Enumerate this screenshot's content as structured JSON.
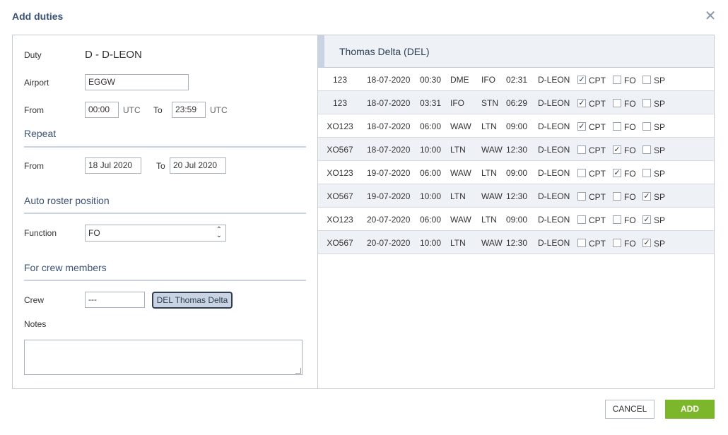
{
  "modal": {
    "title": "Add duties",
    "close_icon": "close-icon"
  },
  "form": {
    "duty_label": "Duty",
    "duty_value": "D - D-LEON",
    "airport_label": "Airport",
    "airport_value": "EGGW",
    "from_label": "From",
    "from_time": "00:00",
    "utc1": "UTC",
    "to_label": "To",
    "to_time": "23:59",
    "utc2": "UTC",
    "repeat_title": "Repeat",
    "repeat_from_label": "From",
    "repeat_from": "18 Jul 2020",
    "repeat_to_label": "To",
    "repeat_to": "20 Jul 2020",
    "auto_roster_title": "Auto roster position",
    "function_label": "Function",
    "function_value": "FO",
    "crew_members_title": "For crew members",
    "crew_label": "Crew",
    "crew_input": "---",
    "crew_chip": "DEL Thomas Delta",
    "notes_label": "Notes"
  },
  "crew_panel": {
    "crew_name": "Thomas Delta (DEL)",
    "rows": [
      {
        "flight": "123",
        "date": "18-07-2020",
        "dep_time": "00:30",
        "from": "DME",
        "to": "IFO",
        "arr_time": "02:31",
        "reg": "D-LEON",
        "cpt": true,
        "fo": false,
        "sp": false
      },
      {
        "flight": "123",
        "date": "18-07-2020",
        "dep_time": "03:31",
        "from": "IFO",
        "to": "STN",
        "arr_time": "06:29",
        "reg": "D-LEON",
        "cpt": true,
        "fo": false,
        "sp": false
      },
      {
        "flight": "XO123",
        "date": "18-07-2020",
        "dep_time": "06:00",
        "from": "WAW",
        "to": "LTN",
        "arr_time": "09:00",
        "reg": "D-LEON",
        "cpt": true,
        "fo": false,
        "sp": false
      },
      {
        "flight": "XO567",
        "date": "18-07-2020",
        "dep_time": "10:00",
        "from": "LTN",
        "to": "WAW",
        "arr_time": "12:30",
        "reg": "D-LEON",
        "cpt": false,
        "fo": true,
        "sp": false
      },
      {
        "flight": "XO123",
        "date": "19-07-2020",
        "dep_time": "06:00",
        "from": "WAW",
        "to": "LTN",
        "arr_time": "09:00",
        "reg": "D-LEON",
        "cpt": false,
        "fo": true,
        "sp": false
      },
      {
        "flight": "XO567",
        "date": "19-07-2020",
        "dep_time": "10:00",
        "from": "LTN",
        "to": "WAW",
        "arr_time": "12:30",
        "reg": "D-LEON",
        "cpt": false,
        "fo": false,
        "sp": true
      },
      {
        "flight": "XO123",
        "date": "20-07-2020",
        "dep_time": "06:00",
        "from": "WAW",
        "to": "LTN",
        "arr_time": "09:00",
        "reg": "D-LEON",
        "cpt": false,
        "fo": false,
        "sp": true
      },
      {
        "flight": "XO567",
        "date": "20-07-2020",
        "dep_time": "10:00",
        "from": "LTN",
        "to": "WAW",
        "arr_time": "12:30",
        "reg": "D-LEON",
        "cpt": false,
        "fo": false,
        "sp": true
      }
    ],
    "cpt_label": "CPT",
    "fo_label": "FO",
    "sp_label": "SP"
  },
  "footer": {
    "cancel_label": "CANCEL",
    "add_label": "ADD"
  },
  "colors": {
    "accent": "#3a5274",
    "add_button": "#7cb62a",
    "row_alt": "#eef2f7"
  }
}
